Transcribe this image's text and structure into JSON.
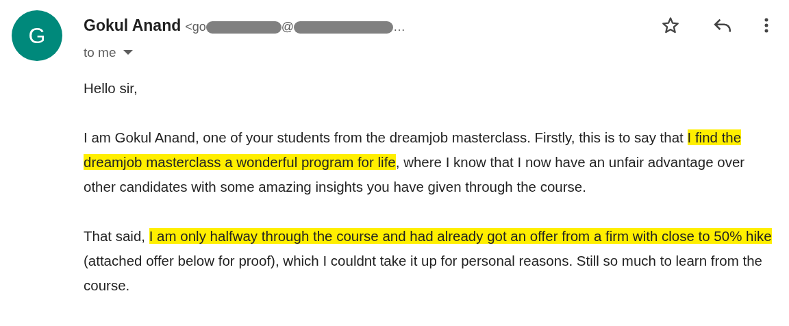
{
  "avatar": {
    "letter": "G",
    "color": "#00897b"
  },
  "sender": {
    "name": "Gokul Anand",
    "email_parts": [
      "<go",
      "@",
      "…"
    ]
  },
  "recipient": {
    "label": "to me"
  },
  "paragraphs": [
    [
      {
        "text": "Hello sir,",
        "highlighted": false
      }
    ],
    [
      {
        "text": "I am Gokul Anand, one of your students from the dreamjob masterclass. Firstly, this is to say that ",
        "highlighted": false
      },
      {
        "text": "I find the dreamjob masterclass a wonderful program for life",
        "highlighted": true
      },
      {
        "text": ", where I know that I now have an unfair advantage over other candidates with some amazing insights you have given through the course.",
        "highlighted": false
      }
    ],
    [
      {
        "text": "That said, ",
        "highlighted": false
      },
      {
        "text": "I am only halfway through the course and had already got an offer from a firm with close to 50% hike",
        "highlighted": true
      },
      {
        "text": " (attached offer below for proof), which I couldnt take it up for personal reasons. Still so much to learn from the course.",
        "highlighted": false
      }
    ]
  ]
}
